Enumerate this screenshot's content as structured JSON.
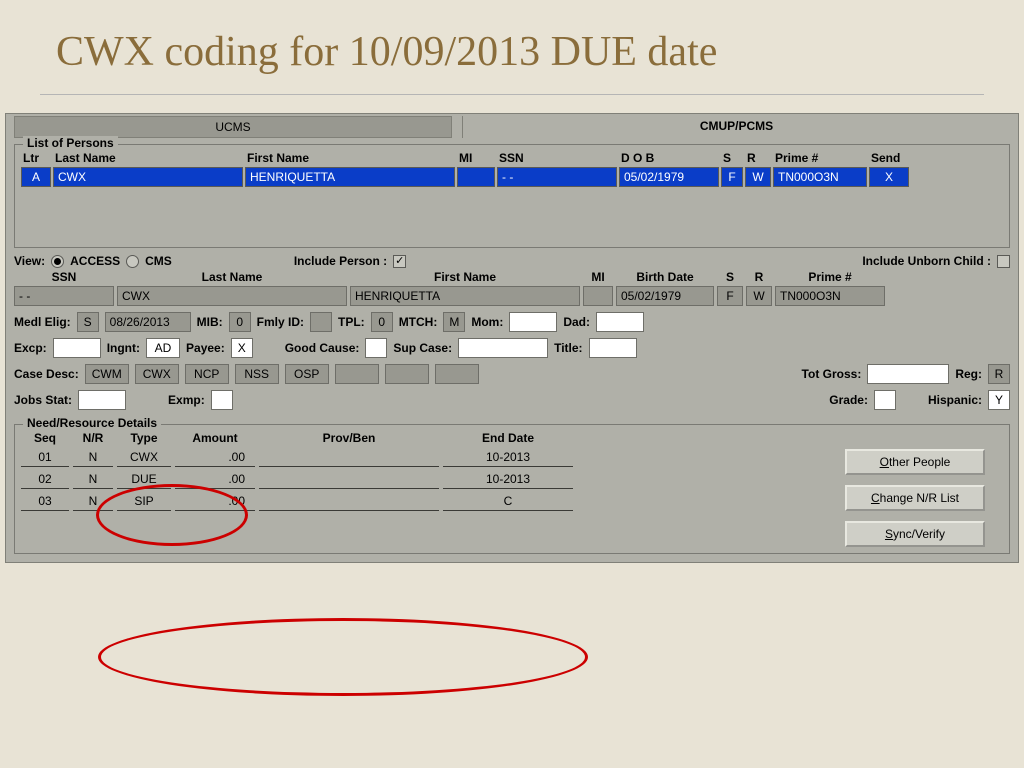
{
  "slide_title": "CWX coding for 10/09/2013 DUE date",
  "tabs": {
    "left": "UCMS",
    "right": "CMUP/PCMS"
  },
  "list": {
    "legend": "List of Persons",
    "headers": {
      "ltr": "Ltr",
      "last": "Last Name",
      "first": "First Name",
      "mi": "MI",
      "ssn": "SSN",
      "dob": "D O B",
      "s": "S",
      "r": "R",
      "prime": "Prime #",
      "send": "Send"
    },
    "row": {
      "ltr": "A",
      "last": "CWX",
      "first": "HENRIQUETTA",
      "mi": "",
      "ssn": "-  -",
      "dob": "05/02/1979",
      "s": "F",
      "r": "W",
      "prime": "TN000O3N",
      "send": "X"
    }
  },
  "view": {
    "label": "View:",
    "access": "ACCESS",
    "cms": "CMS",
    "include_person_label": "Include Person :",
    "include_person": "✓",
    "include_unborn_label": "Include Unborn Child :"
  },
  "detail_headers": {
    "ssn": "SSN",
    "last": "Last Name",
    "first": "First Name",
    "mi": "MI",
    "dob": "Birth Date",
    "s": "S",
    "r": "R",
    "prime": "Prime #"
  },
  "detail": {
    "ssn": "-  -",
    "last": "CWX",
    "first": "HENRIQUETTA",
    "mi": "",
    "dob": "05/02/1979",
    "s": "F",
    "r": "W",
    "prime": "TN000O3N"
  },
  "row1": {
    "medl_elig_label": "Medl Elig:",
    "medl_elig": "S",
    "medl_date": "08/26/2013",
    "mib_label": "MIB:",
    "mib": "0",
    "fmly_label": "Fmly ID:",
    "fmly": "",
    "tpl_label": "TPL:",
    "tpl": "0",
    "mtch_label": "MTCH:",
    "mtch": "M",
    "mom_label": "Mom:",
    "mom": "",
    "dad_label": "Dad:",
    "dad": ""
  },
  "row2": {
    "excp_label": "Excp:",
    "excp": "",
    "ingnt_label": "Ingnt:",
    "ingnt": "AD",
    "payee_label": "Payee:",
    "payee": "X",
    "good_cause_label": "Good Cause:",
    "good_cause": "",
    "sup_case_label": "Sup Case:",
    "sup_case": "",
    "title_label": "Title:",
    "title": ""
  },
  "row3": {
    "case_desc_label": "Case Desc:",
    "cd1": "CWM",
    "cd2": "CWX",
    "cd3": "NCP",
    "cd4": "NSS",
    "cd5": "OSP",
    "cd6": "",
    "cd7": "",
    "cd8": "",
    "tot_gross_label": "Tot Gross:",
    "tot_gross": "",
    "reg_label": "Reg:",
    "reg": "R"
  },
  "row4": {
    "jobs_label": "Jobs Stat:",
    "jobs": "",
    "exmp_label": "Exmp:",
    "exmp": "",
    "grade_label": "Grade:",
    "grade": "",
    "hisp_label": "Hispanic:",
    "hisp": "Y"
  },
  "nr": {
    "legend": "Need/Resource Details",
    "hdr": {
      "seq": "Seq",
      "nr": "N/R",
      "type": "Type",
      "amount": "Amount",
      "prov": "Prov/Ben",
      "end": "End Date"
    },
    "rows": [
      {
        "seq": "01",
        "nr": "N",
        "type": "CWX",
        "amount": ".00",
        "prov": "",
        "end": "10-2013"
      },
      {
        "seq": "02",
        "nr": "N",
        "type": "DUE",
        "amount": ".00",
        "prov": "",
        "end": "10-2013"
      },
      {
        "seq": "03",
        "nr": "N",
        "type": "SIP",
        "amount": ".00",
        "prov": "",
        "end": "C"
      }
    ]
  },
  "buttons": {
    "other_u": "O",
    "other_rest": "ther People",
    "change_u": "C",
    "change_rest": "hange N/R List",
    "sync_u": "S",
    "sync_rest": "ync/Verify"
  }
}
